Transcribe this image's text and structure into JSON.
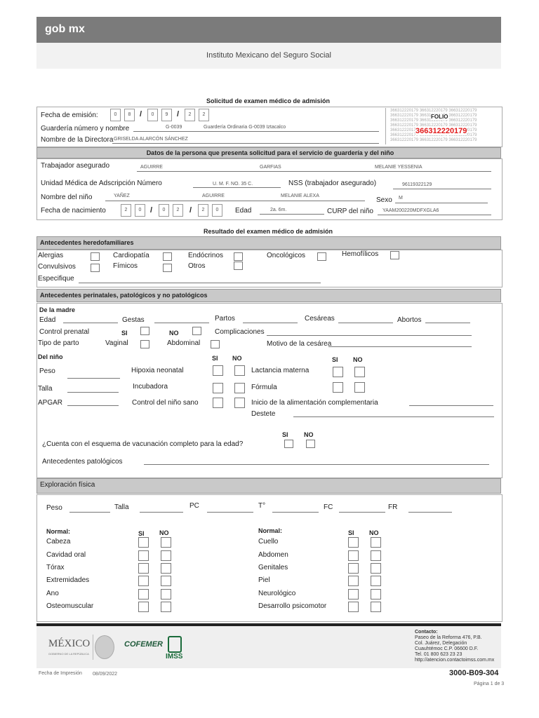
{
  "header": {
    "logo": "gob mx",
    "institute": "Instituto Mexicano del Seguro Social"
  },
  "s1": {
    "title": "Solicitud de examen médico de admisión",
    "fecha_label": "Fecha de emisión:",
    "fecha_digits": [
      "0",
      "8",
      "0",
      "9",
      "2",
      "2"
    ],
    "guarderia_label": "Guardería número y nombre",
    "guarderia_num": "G-0039",
    "guarderia_nombre": "Guardería Ordinaria G-0039 Iztacalco",
    "directora_label": "Nombre de la Directora",
    "directora": "GRISELDA ALARCÓN SÁNCHEZ",
    "folio_label": "FOLIO",
    "folio": "366312220179",
    "folio_bg": "366312220179 366312220179 366312220179"
  },
  "s2": {
    "title": "Datos de la persona que presenta solicitud para el servicio de guardería y del niño",
    "trabajador_label": "Trabajador asegurado",
    "trab_ap1": "AGUIRRE",
    "trab_ap2": "GARFIAS",
    "trab_nombre": "MELANIE YESSENIA",
    "umf_label": "Unidad Médica de Adscripción Número",
    "umf": "U. M. F. NO. 35 C.",
    "nss_label": "NSS (trabajador asegurado)",
    "nss": "96119322129",
    "nino_label": "Nombre del niño",
    "nino_ap1": "YAÑEZ",
    "nino_ap2": "AGUIRRE",
    "nino_nombre": "MELANIE ALEXA",
    "sexo_label": "Sexo",
    "sexo": "M",
    "nac_label": "Fecha de nacimiento",
    "nac_digits": [
      "2",
      "0",
      "0",
      "2",
      "2",
      "0"
    ],
    "edad_label": "Edad",
    "edad": "2a. 6m.",
    "curp_label": "CURP del niño",
    "curp": "YAAM200220MDFXGLA6"
  },
  "s3": {
    "title": "Resultado del examen médico de admisión",
    "here_title": "Antecedentes heredofamiliares",
    "alergias": "Alergias",
    "cardiopatia": "Cardiopatía",
    "endocrinos": "Endócrinos",
    "oncologicos": "Oncológicos",
    "hemofilicos": "Hemofílicos",
    "convulsivos": "Convulsivos",
    "fimicos": "Fímicos",
    "otros": "Otros",
    "especifique": "Especifique"
  },
  "s4": {
    "title": "Antecedentes perinatales, patológicos y no patológicos",
    "madre": "De la madre",
    "edad": "Edad",
    "gestas": "Gestas",
    "partos": "Partos",
    "cesareas": "Cesáreas",
    "abortos": "Abortos",
    "control": "Control prenatal",
    "si": "SI",
    "no": "NO",
    "complicaciones": "Complicaciones",
    "tipo_parto": "Tipo de parto",
    "vaginal": "Vaginal",
    "abdominal": "Abdominal",
    "motivo": "Motivo de la cesárea",
    "nino": "Del niño",
    "peso": "Peso",
    "hipoxia": "Hipoxia neonatal",
    "lactancia": "Lactancia materna",
    "talla": "Talla",
    "incubadora": "Incubadora",
    "formula": "Fórmula",
    "apgar": "APGAR",
    "control_sano": "Control del niño sano",
    "inicio_alim": "Inicio de la alimentación complementaria",
    "destete": "Destete",
    "vacunacion": "¿Cuenta con el esquema de vacunación completo para la edad?",
    "patologicos": "Antecedentes patológicos"
  },
  "s5": {
    "title": "Exploración física",
    "peso": "Peso",
    "talla": "Talla",
    "pc": "PC",
    "temp": "T°",
    "fc": "FC",
    "fr": "FR",
    "normal": "Normal:",
    "si": "SI",
    "no": "NO",
    "left": [
      "Cabeza",
      "Cavidad oral",
      "Tórax",
      "Extremidades",
      "Ano",
      "Osteomuscular"
    ],
    "right": [
      "Cuello",
      "Abdomen",
      "Genitales",
      "Piel",
      "Neurológico",
      "Desarrollo psicomotor"
    ]
  },
  "footer": {
    "mexico": "MÉXICO",
    "gobierno": "GOBIERNO DE LA REPÚBLICA",
    "cofemer": "COFEMER",
    "imss": "IMSS",
    "contacto": "Contacto:",
    "addr": [
      "Paseo de la Reforma 476, P.B.",
      "Col. Juárez, Delegación",
      "Cuauhtémoc C.P. 06600 D.F.",
      "Tel. 01 800 623 23 23",
      "http://atencion.contactoimss.com.mx"
    ],
    "impresion_label": "Fecha de Impresión",
    "impresion": "08/09/2022",
    "code": "3000-B09-304",
    "pagina": "Página 1 de 3"
  }
}
